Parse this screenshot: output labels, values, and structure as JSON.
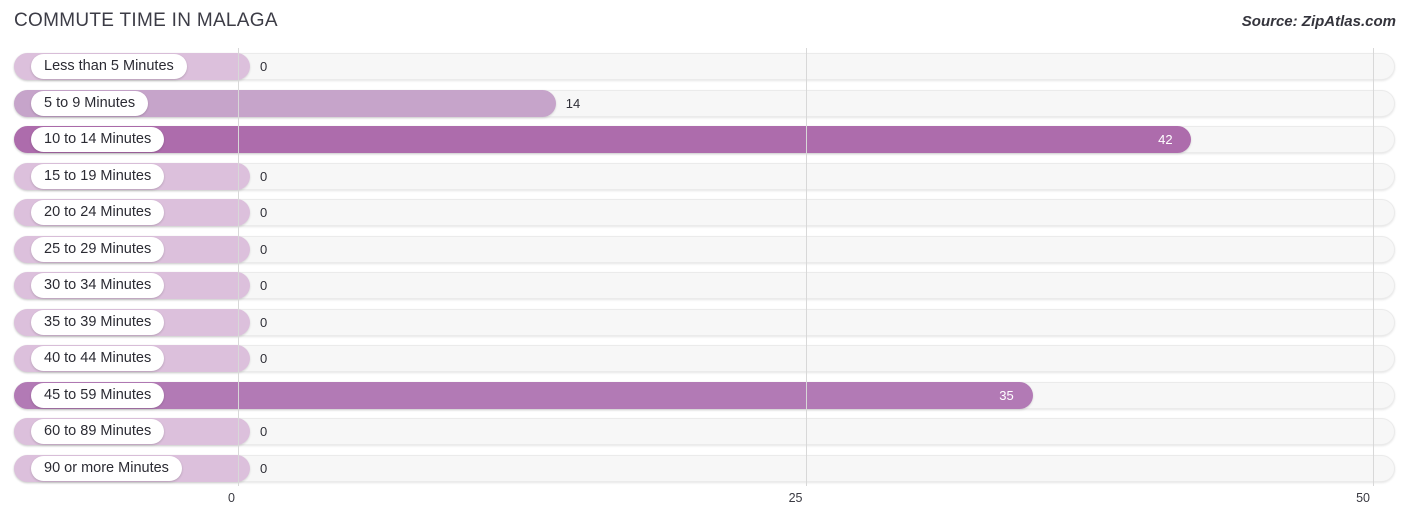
{
  "header": {
    "title": "COMMUTE TIME IN MALAGA",
    "source": "Source: ZipAtlas.com"
  },
  "axis": {
    "ticks": [
      "0",
      "25",
      "50"
    ]
  },
  "colors": {
    "bar_zero": "#dcc0dc",
    "bar_low": "#c6a4ca",
    "bar_mid": "#b27ab5",
    "bar_high": "#ad6cac",
    "track": "#f7f7f7",
    "gridline": "#d8d8d8",
    "title": "#3c3c46"
  },
  "chart_data": {
    "type": "bar",
    "orientation": "horizontal",
    "title": "COMMUTE TIME IN MALAGA",
    "xlabel": "",
    "ylabel": "",
    "xlim": [
      0,
      50
    ],
    "xticks": [
      0,
      25,
      50
    ],
    "grid": true,
    "legend": false,
    "categories": [
      "Less than 5 Minutes",
      "5 to 9 Minutes",
      "10 to 14 Minutes",
      "15 to 19 Minutes",
      "20 to 24 Minutes",
      "25 to 29 Minutes",
      "30 to 34 Minutes",
      "35 to 39 Minutes",
      "40 to 44 Minutes",
      "45 to 59 Minutes",
      "60 to 89 Minutes",
      "90 or more Minutes"
    ],
    "values": [
      0,
      14,
      42,
      0,
      0,
      0,
      0,
      0,
      0,
      35,
      0,
      0
    ],
    "value_labels": [
      "0",
      "14",
      "42",
      "0",
      "0",
      "0",
      "0",
      "0",
      "0",
      "35",
      "0",
      "0"
    ]
  },
  "rows": [
    {
      "label": "Less than 5 Minutes",
      "value": 0,
      "value_label": "0",
      "inside": false,
      "color": "#dcc0dc"
    },
    {
      "label": "5 to 9 Minutes",
      "value": 14,
      "value_label": "14",
      "inside": false,
      "color": "#c6a4ca"
    },
    {
      "label": "10 to 14 Minutes",
      "value": 42,
      "value_label": "42",
      "inside": true,
      "color": "#ad6cac"
    },
    {
      "label": "15 to 19 Minutes",
      "value": 0,
      "value_label": "0",
      "inside": false,
      "color": "#dcc0dc"
    },
    {
      "label": "20 to 24 Minutes",
      "value": 0,
      "value_label": "0",
      "inside": false,
      "color": "#dcc0dc"
    },
    {
      "label": "25 to 29 Minutes",
      "value": 0,
      "value_label": "0",
      "inside": false,
      "color": "#dcc0dc"
    },
    {
      "label": "30 to 34 Minutes",
      "value": 0,
      "value_label": "0",
      "inside": false,
      "color": "#dcc0dc"
    },
    {
      "label": "35 to 39 Minutes",
      "value": 0,
      "value_label": "0",
      "inside": false,
      "color": "#dcc0dc"
    },
    {
      "label": "40 to 44 Minutes",
      "value": 0,
      "value_label": "0",
      "inside": false,
      "color": "#dcc0dc"
    },
    {
      "label": "45 to 59 Minutes",
      "value": 35,
      "value_label": "35",
      "inside": true,
      "color": "#b27ab5"
    },
    {
      "label": "60 to 89 Minutes",
      "value": 0,
      "value_label": "0",
      "inside": false,
      "color": "#dcc0dc"
    },
    {
      "label": "90 or more Minutes",
      "value": 0,
      "value_label": "0",
      "inside": false,
      "color": "#dcc0dc"
    }
  ]
}
